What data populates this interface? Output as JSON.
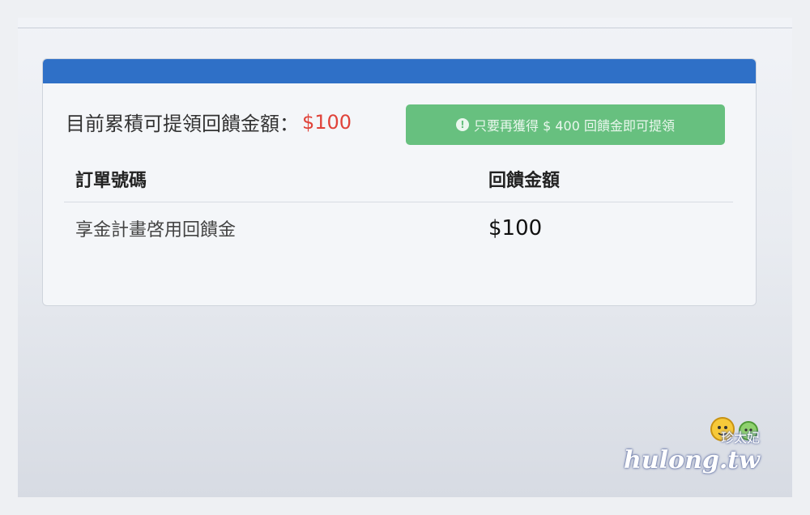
{
  "summary": {
    "label": "目前累積可提領回饋金額：",
    "amount": "$100"
  },
  "hint": {
    "text": "只要再獲得 $ 400 回饋金即可提領"
  },
  "table": {
    "headers": [
      "訂單號碼",
      "回饋金額"
    ],
    "rows": [
      {
        "order": "享金計畫啓用回饋金",
        "amount": "$100"
      }
    ]
  },
  "watermark": {
    "cn": "珍太妃",
    "en": "hulong.tw"
  },
  "colors": {
    "header_bar": "#2f70c7",
    "amount_red": "#e0433a",
    "hint_green": "#67c07f"
  }
}
